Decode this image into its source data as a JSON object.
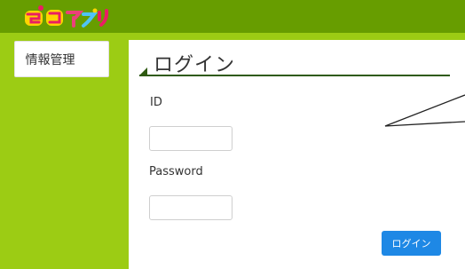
{
  "header": {
    "logo_text": "ジコアプリ"
  },
  "sidebar": {
    "items": [
      {
        "label": "情報管理"
      }
    ]
  },
  "login": {
    "title": "ログイン",
    "id_label": "ID",
    "id_value": "",
    "password_label": "Password",
    "password_value": "",
    "submit_label": "ログイン"
  },
  "colors": {
    "header_bg": "#679d00",
    "page_bg": "#9ccc14",
    "accent_line": "#2f5a12",
    "button_bg": "#1e88e5"
  }
}
